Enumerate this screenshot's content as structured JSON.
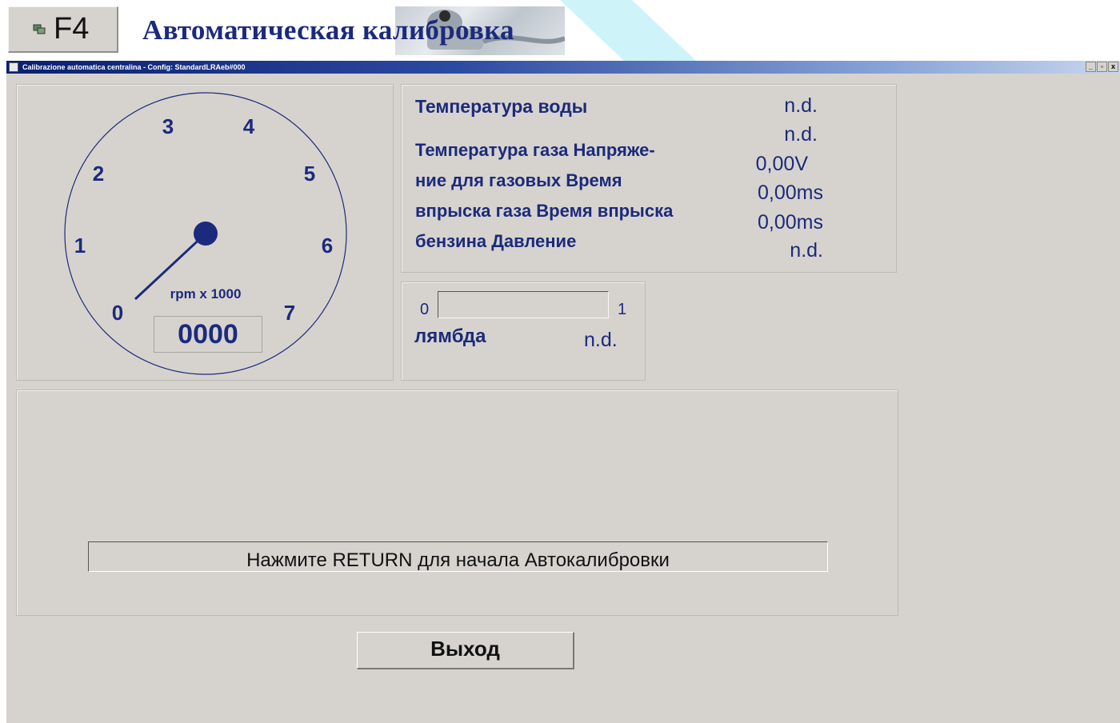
{
  "header": {
    "shortcut_key": "F4",
    "title": "Автоматическая калибровка"
  },
  "window": {
    "title": "Calibrazione automatica centralina - Config: StandardLRAeb#000",
    "controls": [
      "_",
      "▫",
      "x"
    ]
  },
  "gauge": {
    "ticks": [
      "0",
      "1",
      "2",
      "3",
      "4",
      "5",
      "6",
      "7"
    ],
    "unit_label": "rpm x 1000",
    "rpm_value": "0000"
  },
  "info": {
    "labels": [
      "Температура воды",
      "Температура газа Напряже-",
      "ние для газовых Время",
      "впрыска газа Время впрыска",
      "бензина Давление"
    ],
    "values": [
      "n.d.",
      "n.d.",
      "0,00V",
      "0,00ms",
      "0,00ms",
      "n.d."
    ]
  },
  "lambda": {
    "min": "0",
    "max": "1",
    "label": "лямбда",
    "value": "n.d.",
    "level": 0
  },
  "message": {
    "text": "Нажмите RETURN для начала Автокалибровки"
  },
  "exit_button": {
    "label": "Выход"
  },
  "colors": {
    "accent_text": "#1c2a7c",
    "window_bg": "#d6d3ce",
    "titlebar_start": "#0a1f6e"
  }
}
